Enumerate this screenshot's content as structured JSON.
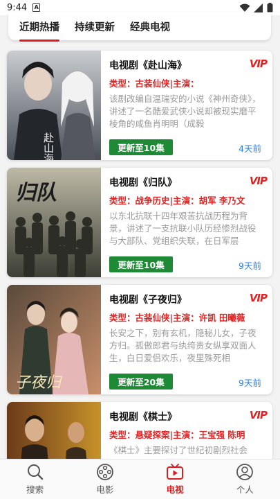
{
  "status_bar": {
    "time": "9:44"
  },
  "top_tabs": [
    {
      "label": "近期热播",
      "active": true
    },
    {
      "label": "持续更新",
      "active": false
    },
    {
      "label": "经典电视",
      "active": false
    }
  ],
  "cards": [
    {
      "title": "电视剧《赴山海》",
      "vip": "VIP",
      "meta": "类型：古装仙侠|主演：",
      "desc": "该剧改编自温瑞安的小说《神州奇侠》，讲述了一名酷爱武侠小说却被现实磨平棱角的咸鱼肖明明（成毅",
      "update": "更新至10集",
      "ago": "4天前",
      "poster_text": "赴山海"
    },
    {
      "title": "电视剧《归队》",
      "vip": "VIP",
      "meta": "类型：战争历史|主演：胡军 李乃文 ",
      "desc": "以东北抗联十四年艰苦抗战历程为背景，讲述了一支抗联小队历经惨烈战役与大部队、党组织失联，在日军层",
      "update": "更新至10集",
      "ago": "9天前",
      "poster_text": "归队"
    },
    {
      "title": "电视剧《子夜归》",
      "vip": "VIP",
      "meta": "类型：古装仙侠|主演：许凯 田曦薇 ",
      "desc": "长安之下，别有玄机，隐秘儿女，子夜方归。孤傲郎君与纨绔贵女纵享双面人生，白日爱侣欢乐，夜里殊死相",
      "update": "更新至20集",
      "ago": "9天前",
      "poster_text": "子夜归"
    },
    {
      "title": "电视剧《棋士》",
      "vip": "VIP",
      "meta": "类型：悬疑探案|主演：王宝强 陈明 ",
      "desc": "《棋士》主要探讨了世纪初剧烈社会",
      "update": "",
      "ago": "",
      "poster_text": ""
    }
  ],
  "bottom_nav": [
    {
      "label": "搜索",
      "icon": "search-icon",
      "active": false
    },
    {
      "label": "电影",
      "icon": "film-reel-icon",
      "active": false
    },
    {
      "label": "电视",
      "icon": "tv-icon",
      "active": true
    },
    {
      "label": "个人",
      "icon": "person-icon",
      "active": false
    }
  ],
  "colors": {
    "accent": "#d81e1e",
    "update_button": "#1f8a36",
    "time_ago": "#2a7de1",
    "desc": "#9a9a9a"
  }
}
